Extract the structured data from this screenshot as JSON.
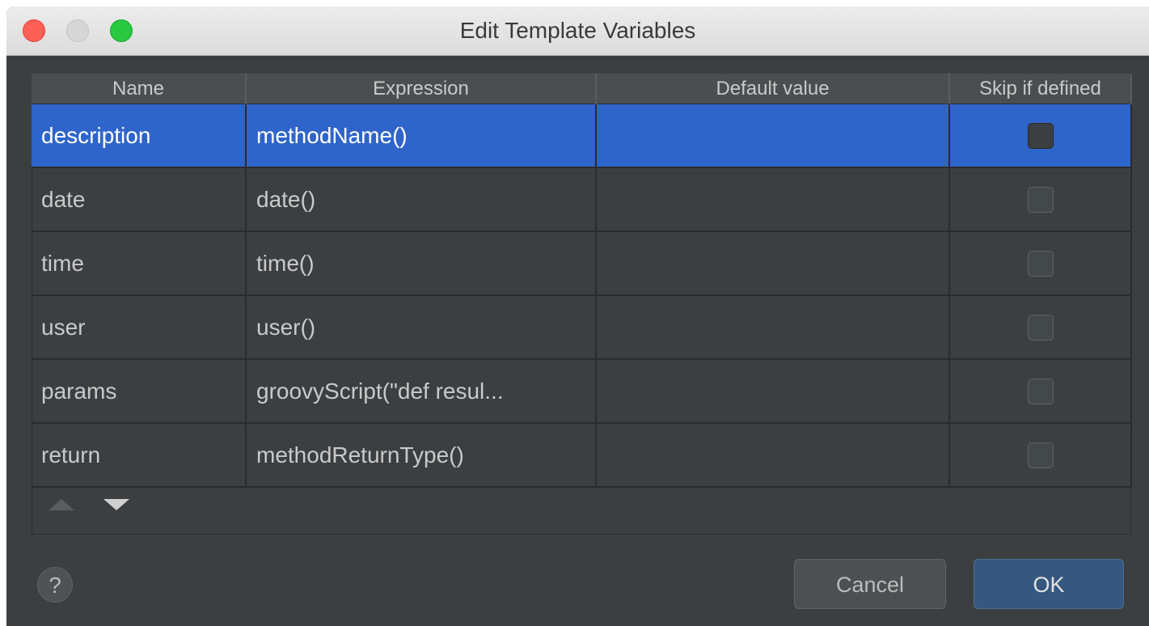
{
  "window": {
    "title": "Edit Template Variables"
  },
  "table": {
    "headers": {
      "name": "Name",
      "expression": "Expression",
      "default": "Default value",
      "skip": "Skip if defined"
    },
    "rows": [
      {
        "name": "description",
        "expression": "methodName()",
        "default": "",
        "skip": false,
        "selected": true
      },
      {
        "name": "date",
        "expression": "date()",
        "default": "",
        "skip": false,
        "selected": false
      },
      {
        "name": "time",
        "expression": "time()",
        "default": "",
        "skip": false,
        "selected": false
      },
      {
        "name": "user",
        "expression": "user()",
        "default": "",
        "skip": false,
        "selected": false
      },
      {
        "name": "params",
        "expression": "groovyScript(\"def resul...",
        "default": "",
        "skip": false,
        "selected": false
      },
      {
        "name": "return",
        "expression": "methodReturnType()",
        "default": "",
        "skip": false,
        "selected": false
      }
    ]
  },
  "footer": {
    "help": "?",
    "cancel": "Cancel",
    "ok": "OK"
  },
  "icons": {
    "up": "move-up-icon",
    "down": "move-down-icon"
  },
  "colors": {
    "selection": "#2f65ca",
    "ok_button": "#365880",
    "close": "#fe5f57",
    "zoom": "#28c840"
  }
}
